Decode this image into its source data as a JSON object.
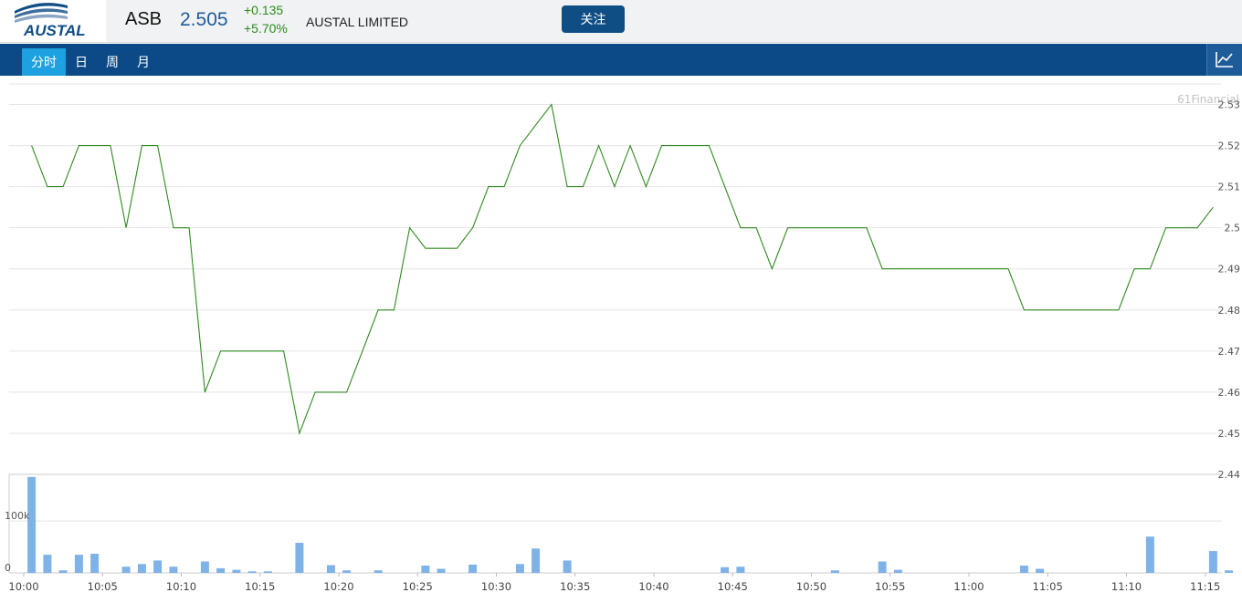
{
  "header": {
    "logo_text": "AUSTAL",
    "symbol": "ASB",
    "price": "2.505",
    "change": "+0.135",
    "change_pct": "+5.70%",
    "company_name": "AUSTAL LIMITED",
    "follow_label": "关注"
  },
  "tabs": [
    {
      "label": "分时",
      "active": true
    },
    {
      "label": "日",
      "active": false
    },
    {
      "label": "周",
      "active": false
    },
    {
      "label": "月",
      "active": false
    }
  ],
  "chart_toggle_icon": "line-chart-icon",
  "colors": {
    "accent": "#0b4a86",
    "active_tab": "#1ea1e0",
    "line": "#2f8a1f",
    "volume_bar": "#7fb3e8",
    "gain": "#2f8a1f"
  },
  "chart_data": [
    {
      "type": "line",
      "watermark": "61Financial",
      "y_ticks": [
        "2.53",
        "2.52",
        "2.51",
        "2.5",
        "2.49",
        "2.48",
        "2.47",
        "2.46",
        "2.45",
        "2.44"
      ],
      "ylim": [
        2.44,
        2.535
      ],
      "x_ticks": [
        "10:00",
        "10:05",
        "10:10",
        "10:15",
        "10:20",
        "10:25",
        "10:30",
        "10:35",
        "10:40",
        "10:45",
        "10:50",
        "10:55",
        "11:00",
        "11:05",
        "11:10",
        "11:15"
      ],
      "xlim_minutes": [
        0,
        76
      ],
      "grid": true,
      "series": [
        {
          "x": [
            0.5,
            1.5,
            2.5,
            3.5,
            4.5,
            5.5,
            6.5,
            7.5,
            8.5,
            9.5,
            10.5,
            11.5,
            12.5,
            13.5,
            14.5,
            15.5,
            16.5,
            17.5,
            18.5,
            19.5,
            20.5,
            21.5,
            22.5,
            23.5,
            24.5,
            25.5,
            26.5,
            27.5,
            28.5,
            29.5,
            30.5,
            31.5,
            32.5,
            33.5,
            34.5,
            35.5,
            36.5,
            37.5,
            38.5,
            39.5,
            40.5,
            41.5,
            42.5,
            43.5,
            44.5,
            45.5,
            46.5,
            47.5,
            48.5,
            49.5,
            50.5,
            51.5,
            52.5,
            53.5,
            54.5,
            55.5,
            56.5,
            57.5,
            58.5,
            59.5,
            60.5,
            61.5,
            62.5,
            63.5,
            64.5,
            65.5,
            66.5,
            67.5,
            68.5,
            69.5,
            70.5,
            71.5,
            72.5,
            73.5,
            74.5,
            75.5
          ],
          "values": [
            2.52,
            2.51,
            2.51,
            2.52,
            2.52,
            2.52,
            2.5,
            2.52,
            2.52,
            2.5,
            2.5,
            2.46,
            2.47,
            2.47,
            2.47,
            2.47,
            2.47,
            2.45,
            2.46,
            2.46,
            2.46,
            2.47,
            2.48,
            2.48,
            2.5,
            2.495,
            2.495,
            2.495,
            2.5,
            2.51,
            2.51,
            2.52,
            2.525,
            2.53,
            2.51,
            2.51,
            2.52,
            2.51,
            2.52,
            2.51,
            2.52,
            2.52,
            2.52,
            2.52,
            2.51,
            2.5,
            2.5,
            2.49,
            2.5,
            2.5,
            2.5,
            2.5,
            2.5,
            2.5,
            2.49,
            2.49,
            2.49,
            2.49,
            2.49,
            2.49,
            2.49,
            2.49,
            2.49,
            2.48,
            2.48,
            2.48,
            2.48,
            2.48,
            2.48,
            2.48,
            2.49,
            2.49,
            2.5,
            2.5,
            2.5,
            2.505
          ]
        }
      ]
    },
    {
      "type": "bar",
      "y_ticks": [
        "100k",
        "0"
      ],
      "ylim": [
        0,
        190000
      ],
      "x": [
        0.5,
        1.5,
        2.5,
        3.5,
        4.5,
        6.5,
        7.5,
        8.5,
        9.5,
        11.5,
        12.5,
        13.5,
        14.5,
        15.5,
        17.5,
        19.5,
        20.5,
        22.5,
        25.5,
        26.5,
        28.5,
        31.5,
        32.5,
        34.5,
        44.5,
        45.5,
        51.5,
        54.5,
        55.5,
        63.5,
        64.5,
        71.5,
        75.5,
        76.5
      ],
      "values": [
        185000,
        35000,
        5000,
        35000,
        37000,
        12000,
        17000,
        24000,
        12000,
        22000,
        9000,
        6000,
        3000,
        3000,
        58000,
        15000,
        5000,
        5000,
        14000,
        8000,
        16000,
        17000,
        47000,
        24000,
        11000,
        12000,
        5000,
        22000,
        6000,
        14000,
        8000,
        70000,
        42000,
        5000
      ]
    }
  ]
}
